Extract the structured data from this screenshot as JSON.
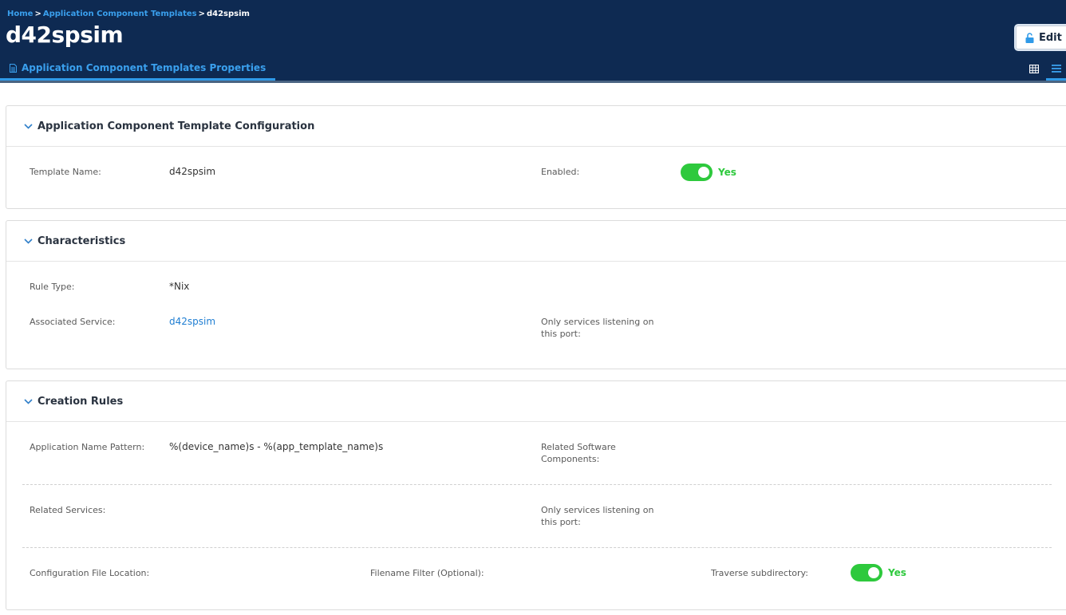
{
  "breadcrumb": {
    "home": "Home",
    "sep": ">",
    "parent": "Application Component Templates",
    "current": "d42spsim"
  },
  "header": {
    "title": "d42spsim",
    "edit_label": "Edit"
  },
  "tabs": {
    "properties_label": "Application Component Templates Properties"
  },
  "icons": {
    "edit": "unlock-icon",
    "tab": "document-icon",
    "grid": "grid-view-icon",
    "list": "list-view-icon",
    "chevron": "chevron-down-icon"
  },
  "colors": {
    "header_bg": "#0e2a52",
    "accent": "#2f9ae8",
    "toggle_on": "#2ec93d",
    "link": "#1f7ed2"
  },
  "config": {
    "title": "Application Component Template Configuration",
    "template_name_label": "Template Name:",
    "template_name_value": "d42spsim",
    "enabled_label": "Enabled:",
    "enabled_value": "Yes"
  },
  "characteristics": {
    "title": "Characteristics",
    "rule_type_label": "Rule Type:",
    "rule_type_value": "*Nix",
    "associated_service_label": "Associated Service:",
    "associated_service_value": "d42spsim",
    "only_listening_label": "Only services listening on this port:"
  },
  "creation_rules": {
    "title": "Creation Rules",
    "app_name_pattern_label": "Application Name Pattern:",
    "app_name_pattern_value": "%(device_name)s - %(app_template_name)s",
    "related_software_label": "Related Software Components:",
    "related_services_label": "Related Services:",
    "only_listening_label": "Only services listening on this port:",
    "config_file_location_label": "Configuration File Location:",
    "filename_filter_label": "Filename Filter (Optional):",
    "traverse_label": "Traverse subdirectory:",
    "traverse_value": "Yes"
  }
}
